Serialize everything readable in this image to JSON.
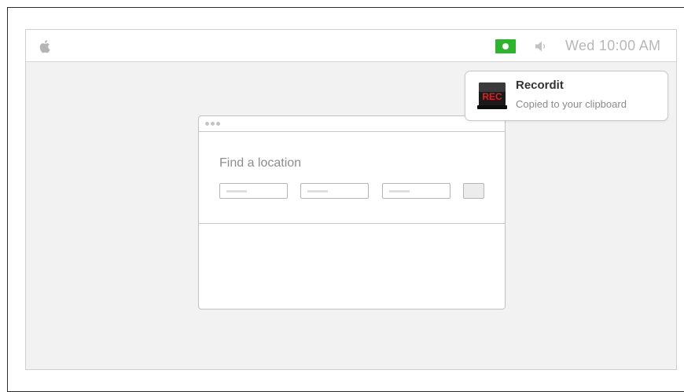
{
  "menubar": {
    "apple_icon": "apple-logo",
    "status_icon": "recording-indicator",
    "status_color": "#2db52d",
    "volume_icon": "volume",
    "clock": "Wed 10:00 AM"
  },
  "notification": {
    "app_icon_text": "REC",
    "title": "Recordit",
    "body": "Copied to your clipboard"
  },
  "window": {
    "form_title": "Find a location",
    "fields": [
      "",
      "",
      ""
    ]
  }
}
